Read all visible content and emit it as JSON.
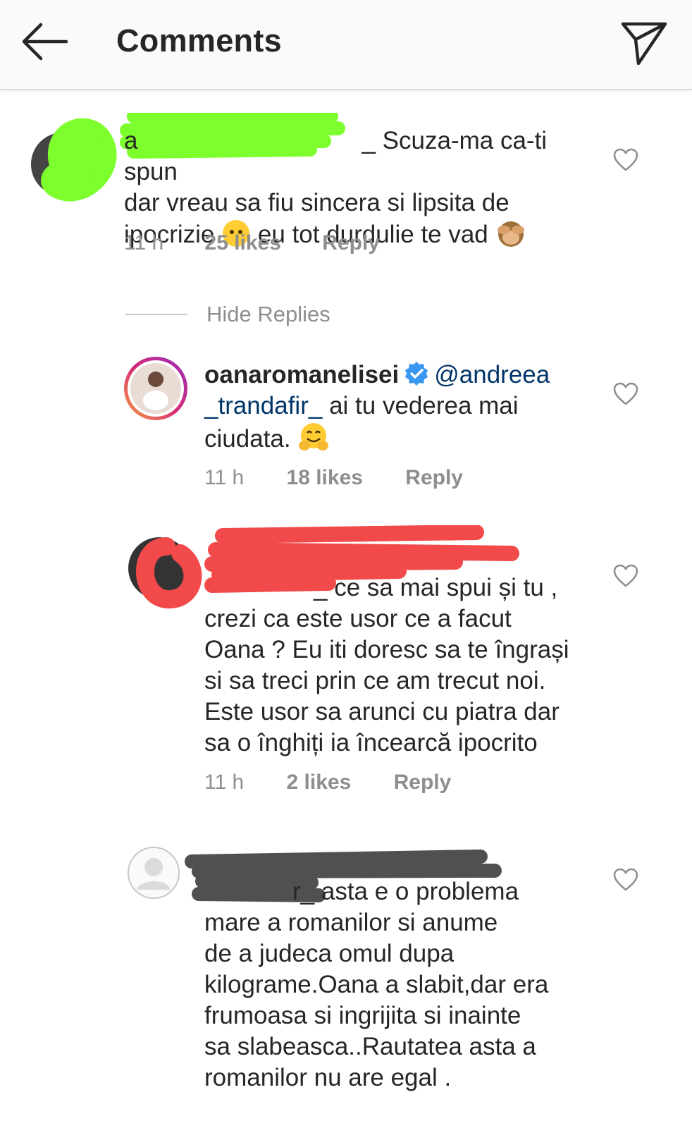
{
  "header": {
    "title": "Comments",
    "back_icon": "arrow-left-icon",
    "send_icon": "paper-plane-icon"
  },
  "comments": [
    {
      "username_fragment": "a",
      "username_tail": "_",
      "text": "Scuza-ma ca-ti spun",
      "text2": "dar vreau sa fiu sincera si lipsita de",
      "text3_a": "ipocrizie",
      "text3_b": "eu tot durdulie te vad",
      "emoji1": "neutral-face-emoji",
      "emoji2": "see-no-evil-monkey-emoji",
      "time": "11 h",
      "likes": "25 likes",
      "reply": "Reply",
      "scribble_color": "#7cff2c"
    }
  ],
  "hide_replies": "Hide Replies",
  "replies": [
    {
      "username": "oanaromanelisei",
      "mention": "@andreea",
      "mention2": "_trandafir_",
      "text_a": "ai tu vederea mai",
      "text_b": "ciudata.",
      "emoji": "hugging-face-emoji",
      "time": "11 h",
      "likes": "18 likes",
      "reply": "Reply"
    },
    {
      "fragment": "_",
      "line1": "ce sa mai spui și tu ,",
      "line2": "crezi ca este usor ce a facut",
      "line3": "Oana ? Eu  iti doresc sa te îngrași",
      "line4": "si sa treci prin ce am trecut noi.",
      "line5": "Este usor sa arunci cu piatra dar",
      "line6": "sa o înghiți ia încearcă ipocrito",
      "time": "11 h",
      "likes": "2 likes",
      "reply": "Reply",
      "scribble_color": "#f24a4a"
    },
    {
      "fragment": "r_",
      "line1": "asta e o problema",
      "line2": "mare a romanilor  si anume",
      "line3": "de a judeca omul dupa",
      "line4": "kilograme.Oana a slabit,dar era",
      "line5": "frumoasa si ingrijita si inainte",
      "line6": "sa slabeasca..Rautatea asta a",
      "line7": "romanilor nu are egal .",
      "scribble_color": "#505050"
    }
  ],
  "colors": {
    "text": "#262626",
    "meta": "#8e8e8e",
    "mention": "#003569",
    "verified": "#3897f0"
  }
}
